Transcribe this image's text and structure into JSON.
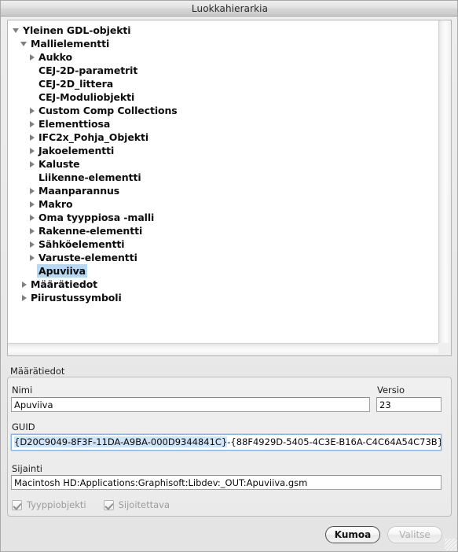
{
  "window": {
    "title": "Luokkahierarkia"
  },
  "tree": {
    "name": "Luokkahierarkia",
    "items": [
      {
        "label": "Yleinen GDL-objekti",
        "depth": 0,
        "state": "open",
        "selected": false
      },
      {
        "label": "Mallielementti",
        "depth": 1,
        "state": "open",
        "selected": false
      },
      {
        "label": "Aukko",
        "depth": 2,
        "state": "closed",
        "selected": false
      },
      {
        "label": "CEJ-2D-parametrit",
        "depth": 2,
        "state": "leaf",
        "selected": false
      },
      {
        "label": "CEJ-2D_littera",
        "depth": 2,
        "state": "leaf",
        "selected": false
      },
      {
        "label": "CEJ-Moduliobjekti",
        "depth": 2,
        "state": "leaf",
        "selected": false
      },
      {
        "label": "Custom Comp Collections",
        "depth": 2,
        "state": "closed",
        "selected": false
      },
      {
        "label": "Elementtiosa",
        "depth": 2,
        "state": "closed",
        "selected": false
      },
      {
        "label": "IFC2x_Pohja_Objekti",
        "depth": 2,
        "state": "closed",
        "selected": false
      },
      {
        "label": "Jakoelementti",
        "depth": 2,
        "state": "closed",
        "selected": false
      },
      {
        "label": "Kaluste",
        "depth": 2,
        "state": "closed",
        "selected": false
      },
      {
        "label": "Liikenne-elementti",
        "depth": 2,
        "state": "leaf",
        "selected": false
      },
      {
        "label": "Maanparannus",
        "depth": 2,
        "state": "closed",
        "selected": false
      },
      {
        "label": "Makro",
        "depth": 2,
        "state": "closed",
        "selected": false
      },
      {
        "label": "Oma tyyppiosa -malli",
        "depth": 2,
        "state": "closed",
        "selected": false
      },
      {
        "label": "Rakenne-elementti",
        "depth": 2,
        "state": "closed",
        "selected": false
      },
      {
        "label": "Sähköelementti",
        "depth": 2,
        "state": "closed",
        "selected": false
      },
      {
        "label": "Varuste-elementti",
        "depth": 2,
        "state": "closed",
        "selected": false
      },
      {
        "label": "Apuviiva",
        "depth": 2,
        "state": "leaf",
        "selected": true
      },
      {
        "label": "Määrätiedot",
        "depth": 1,
        "state": "closed",
        "selected": false
      },
      {
        "label": "Piirustussymboli",
        "depth": 1,
        "state": "closed",
        "selected": false
      }
    ]
  },
  "details": {
    "group_title": "Määrätiedot",
    "name_label": "Nimi",
    "name_value": "Apuviiva",
    "version_label": "Versio",
    "version_value": "23",
    "guid_label": "GUID",
    "guid_selected_part": "{D20C9049-8F3F-11DA-A9BA-000D9344841C}",
    "guid_rest_part": "-{88F4929D-5405-4C3E-B16A-C4C64A54C73B}",
    "location_label": "Sijainti",
    "location_value": "Macintosh HD:Applications:Graphisoft:Libdev:_OUT:Apuviiva.gsm",
    "checkbox_type_object": "Tyyppiobjekti",
    "checkbox_placeable": "Sijoitettava"
  },
  "buttons": {
    "cancel": "Kumoa",
    "select": "Valitse"
  },
  "colors": {
    "selection": "#b5d9f5",
    "text_selection": "#cfe4f7",
    "window_bg": "#ededed",
    "field_bg": "#ffffff"
  }
}
